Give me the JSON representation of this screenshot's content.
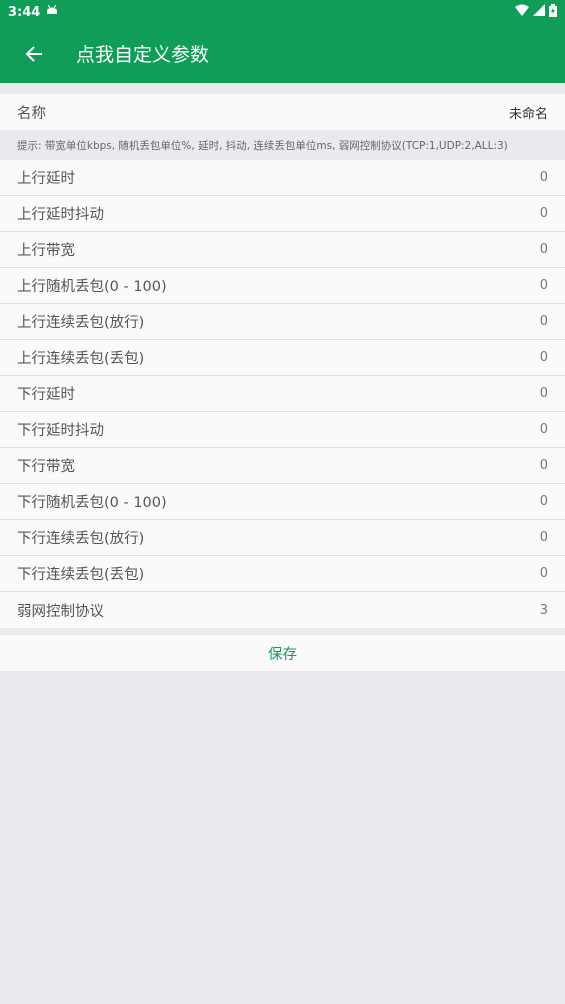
{
  "status_bar": {
    "time": "3:44"
  },
  "app_bar": {
    "title": "点我自定义参数"
  },
  "name_row": {
    "label": "名称",
    "value": "未命名"
  },
  "hint": "提示: 带宽单位kbps, 随机丢包单位%, 延时, 抖动, 连续丢包单位ms, 弱网控制协议(TCP:1,UDP:2,ALL:3)",
  "params": [
    {
      "label": "上行延时",
      "value": "0"
    },
    {
      "label": "上行延时抖动",
      "value": "0"
    },
    {
      "label": "上行带宽",
      "value": "0"
    },
    {
      "label": "上行随机丢包(0 - 100)",
      "value": "0"
    },
    {
      "label": "上行连续丢包(放行)",
      "value": "0"
    },
    {
      "label": "上行连续丢包(丢包)",
      "value": "0"
    },
    {
      "label": "下行延时",
      "value": "0"
    },
    {
      "label": "下行延时抖动",
      "value": "0"
    },
    {
      "label": "下行带宽",
      "value": "0"
    },
    {
      "label": "下行随机丢包(0 - 100)",
      "value": "0"
    },
    {
      "label": "下行连续丢包(放行)",
      "value": "0"
    },
    {
      "label": "下行连续丢包(丢包)",
      "value": "0"
    },
    {
      "label": "弱网控制协议",
      "value": "3"
    }
  ],
  "save_label": "保存",
  "colors": {
    "accent": "#0f9d58",
    "background": "#e9eaee"
  },
  "icons": {
    "back": "arrow-left-icon",
    "status_app": "android-icon",
    "wifi": "wifi-icon",
    "signal": "signal-icon",
    "battery": "battery-icon"
  }
}
